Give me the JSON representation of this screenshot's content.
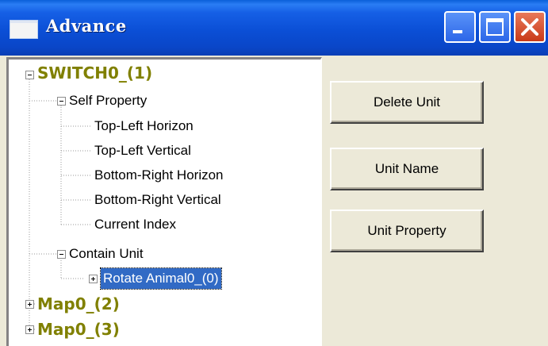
{
  "window": {
    "title": "Advance",
    "controls": [
      "minimize-icon",
      "maximize-icon",
      "close-icon"
    ],
    "colors": {
      "title_bar": "#0a4fd6",
      "close_button": "#d4451f",
      "root_node_text": "#808000",
      "selection": "#316ac5"
    }
  },
  "tree": {
    "root1": "SWITCH0_(1)",
    "self_property": "Self Property",
    "properties": [
      "Top-Left Horizon",
      "Top-Left Vertical",
      "Bottom-Right Horizon",
      "Bottom-Right Vertical",
      "Current Index"
    ],
    "contain_unit": "Contain Unit",
    "selected_unit": "Rotate Animal0_(0)",
    "root2": "Map0_(2)",
    "root3": "Map0_(3)"
  },
  "buttons": {
    "delete_unit": "Delete Unit",
    "unit_name": "Unit Name",
    "unit_property": "Unit Property"
  }
}
